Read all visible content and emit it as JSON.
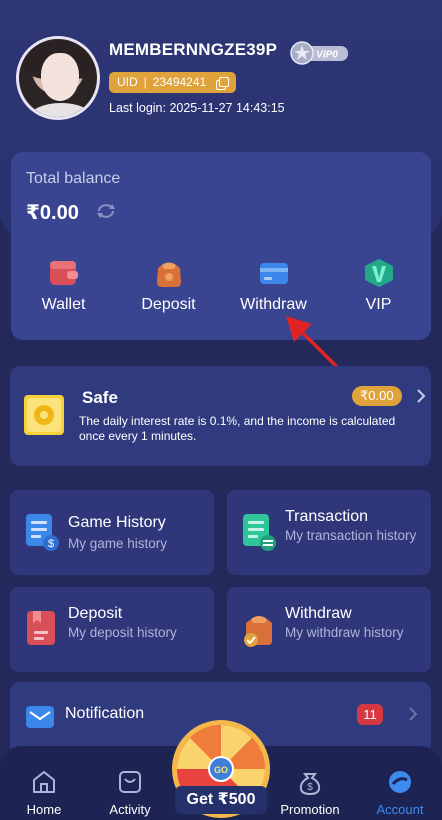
{
  "profile": {
    "username": "MEMBERNNGZE39P",
    "vip_level": "VIP0",
    "uid_label": "UID",
    "uid_value": "23494241",
    "last_login": "Last login: 2025-11-27 14:43:15"
  },
  "balance": {
    "label": "Total balance",
    "amount": "₹0.00"
  },
  "actions": [
    {
      "label": "Wallet",
      "icon": "wallet-icon",
      "color": "#e0545c"
    },
    {
      "label": "Deposit",
      "icon": "deposit-bag-icon",
      "color": "#e07a36"
    },
    {
      "label": "Withdraw",
      "icon": "withdraw-card-icon",
      "color": "#3f8ff0"
    },
    {
      "label": "VIP",
      "icon": "vip-diamond-icon",
      "color": "#3ad0b0"
    }
  ],
  "safe": {
    "title": "Safe",
    "amount": "₹0.00",
    "description": "The daily interest rate is 0.1%, and the income is calculated once every 1 minutes."
  },
  "history_cards": [
    {
      "title": "Game History",
      "subtitle": "My game history",
      "icon": "game-history-icon",
      "color": "#3f8ff0"
    },
    {
      "title": "Transaction",
      "subtitle": "My transaction history",
      "icon": "transaction-icon",
      "color": "#2fc59a"
    },
    {
      "title": "Deposit",
      "subtitle": "My deposit history",
      "icon": "deposit-history-icon",
      "color": "#e0545c"
    },
    {
      "title": "Withdraw",
      "subtitle": "My withdraw history",
      "icon": "withdraw-history-icon",
      "color": "#e07a36"
    }
  ],
  "notification": {
    "label": "Notification",
    "count": "11"
  },
  "bottom_nav": [
    {
      "label": "Home",
      "icon": "home-icon"
    },
    {
      "label": "Activity",
      "icon": "activity-icon"
    },
    {
      "label": "Promotion",
      "icon": "promotion-icon"
    },
    {
      "label": "Account",
      "icon": "account-icon",
      "active": true
    }
  ],
  "spin_wheel": {
    "center_label": "GO",
    "button_label": "Get ₹500"
  },
  "colors": {
    "background": "#24295b",
    "card": "#303a7e",
    "accent_gold": "#e0a23a",
    "accent_blue": "#3e8bf0",
    "badge_red": "#d53840"
  }
}
